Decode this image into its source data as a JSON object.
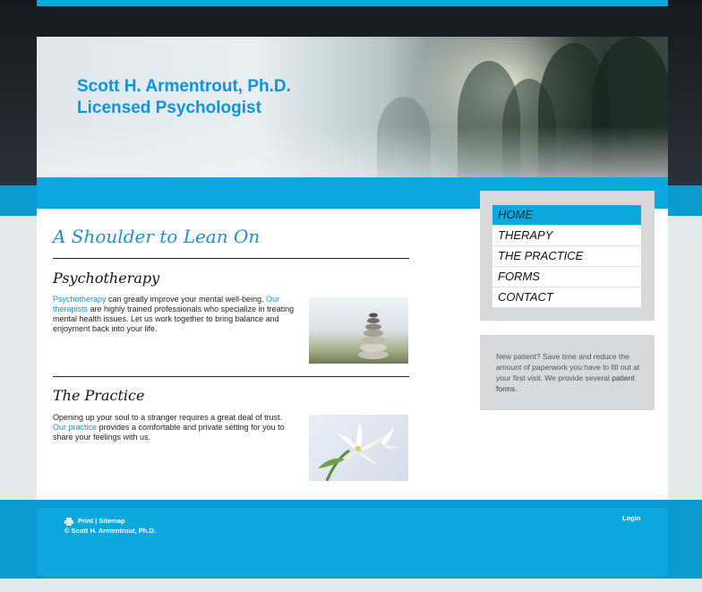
{
  "header": {
    "title_line1": "Scott H. Armentrout, Ph.D.",
    "title_line2": "Licensed Psychologist"
  },
  "main": {
    "heading": "A Shoulder to Lean On",
    "sections": [
      {
        "title": "Psychotherapy",
        "link1": "Psychotherapy",
        "text1": " can greatly improve your mental well-being. ",
        "link2": "Our therapists",
        "text2": " are highly trained professionals who specialize in treating mental health issues. Let us work together to bring balance and enjoyment back into your life.",
        "image": "stacked-stones"
      },
      {
        "title": "The Practice",
        "text1": "Opening up your soul to a stranger requires a great deal of trust. ",
        "link1": "Our practice",
        "text2": " provides a comfortable and private setting for you to share your feelings with us.",
        "image": "white-lily"
      }
    ]
  },
  "nav": {
    "items": [
      {
        "label": "HOME",
        "active": true
      },
      {
        "label": "THERAPY",
        "active": false
      },
      {
        "label": "THE PRACTICE",
        "active": false
      },
      {
        "label": "FORMS",
        "active": false
      },
      {
        "label": "CONTACT",
        "active": false
      }
    ]
  },
  "sidebar": {
    "text": "New patient? Save time and reduce the amount of paperwork you have to fill out at your first visit. We provide several ",
    "link": "patient forms",
    "text_end": "."
  },
  "footer": {
    "print": "Print",
    "separator": " | ",
    "sitemap": "Sitemap",
    "copyright": "© Scott H. Armentrout, Ph.D.",
    "login": "Login",
    "print_icon": "printer-icon"
  },
  "colors": {
    "accent": "#0aa8dc",
    "link": "#1e8fc8",
    "title": "#0e92e0"
  }
}
